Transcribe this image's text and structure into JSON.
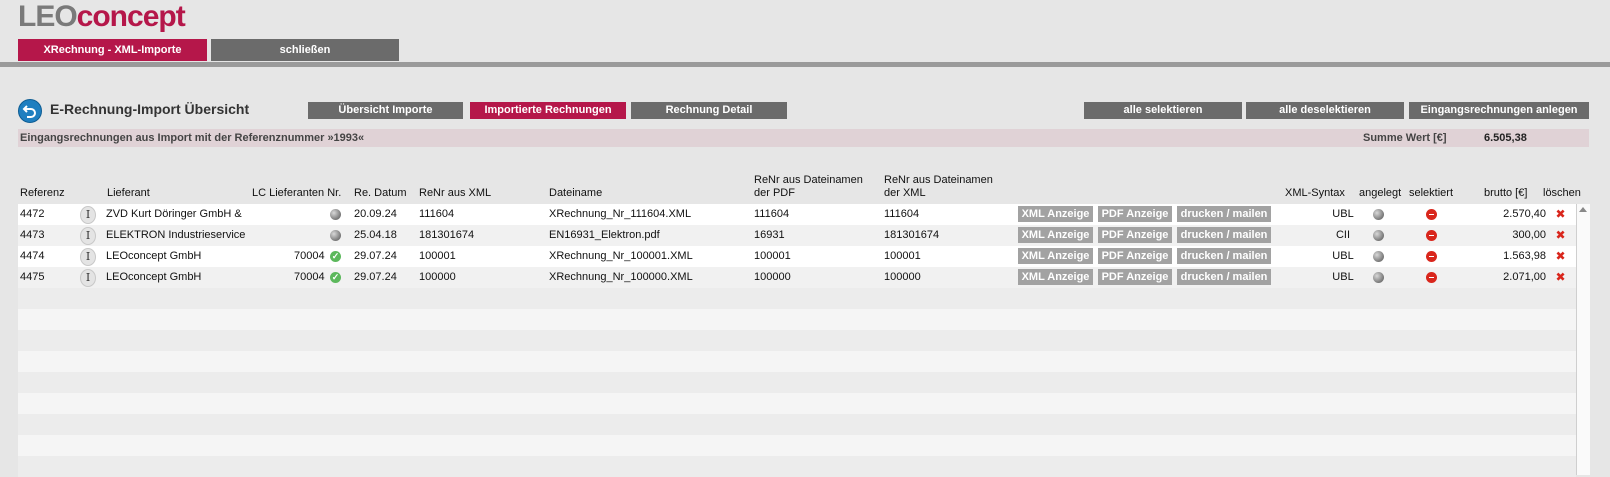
{
  "brand": {
    "part1": "LEO",
    "part2": "concept"
  },
  "top_tabs": [
    "XRechnung - XML-Importe",
    "schließen"
  ],
  "page_title": "E-Rechnung-Import Übersicht",
  "view_tabs": [
    "Übersicht Importe",
    "Importierte Rechnungen",
    "Rechnung Detail"
  ],
  "action_buttons": [
    "alle selektieren",
    "alle deselektieren",
    "Eingangsrechnungen anlegen"
  ],
  "info_bar": {
    "text": "Eingangsrechnungen aus Import mit der Referenznummer »1993«",
    "sum_label": "Summe Wert [€]",
    "sum_value": "6.505,38"
  },
  "columns": {
    "referenz": "Referenz",
    "lieferant": "Lieferant",
    "lc_nr": "LC Lieferanten Nr.",
    "re_datum": "Re. Datum",
    "renr_xml": "ReNr aus XML",
    "dateiname": "Dateiname",
    "renr_pdf_1": "ReNr aus Dateinamen",
    "renr_pdf_2": "der PDF",
    "renr_xmlfile_1": "ReNr aus Dateinamen",
    "renr_xmlfile_2": "der XML",
    "xml_syntax": "XML-Syntax",
    "angelegt": "angelegt",
    "selektiert": "selektiert",
    "brutto": "brutto [€]",
    "loeschen": "löschen"
  },
  "row_buttons": {
    "xml": "XML Anzeige",
    "pdf": "PDF Anzeige",
    "print": "drucken / mailen"
  },
  "info_icon_glyph": "I",
  "rows": [
    {
      "referenz": "4472",
      "lieferant": "ZVD Kurt Döringer GmbH &",
      "lc_nr": "",
      "lc_status": "grey",
      "re_datum": "20.09.24",
      "renr_xml": "111604",
      "dateiname": "XRechnung_Nr_111604.XML",
      "renr_pdf": "111604",
      "renr_xmlfile": "111604",
      "syntax": "UBL",
      "brutto": "2.570,40"
    },
    {
      "referenz": "4473",
      "lieferant": "ELEKTRON Industrieservice",
      "lc_nr": "",
      "lc_status": "grey",
      "re_datum": "25.04.18",
      "renr_xml": "181301674",
      "dateiname": "EN16931_Elektron.pdf",
      "renr_pdf": "16931",
      "renr_xmlfile": "181301674",
      "syntax": "CII",
      "brutto": "300,00"
    },
    {
      "referenz": "4474",
      "lieferant": "LEOconcept GmbH",
      "lc_nr": "70004",
      "lc_status": "green",
      "re_datum": "29.07.24",
      "renr_xml": "100001",
      "dateiname": "XRechnung_Nr_100001.XML",
      "renr_pdf": "100001",
      "renr_xmlfile": "100001",
      "syntax": "UBL",
      "brutto": "1.563,98"
    },
    {
      "referenz": "4475",
      "lieferant": "LEOconcept GmbH",
      "lc_nr": "70004",
      "lc_status": "green",
      "re_datum": "29.07.24",
      "renr_xml": "100000",
      "dateiname": "XRechnung_Nr_100000.XML",
      "renr_pdf": "100000",
      "renr_xmlfile": "100000",
      "syntax": "UBL",
      "brutto": "2.071,00"
    }
  ],
  "colors": {
    "accent": "#b5174a",
    "button_grey": "#6b6b6b",
    "row_button": "#a2a2a2",
    "info_bar": "#e0d2d6"
  },
  "icons": {
    "back": "back-arrow-icon",
    "info": "info-icon",
    "status_grey": "grey-dot-icon",
    "status_ok": "green-check-icon",
    "selected": "red-circle-icon",
    "delete": "red-x-icon"
  }
}
